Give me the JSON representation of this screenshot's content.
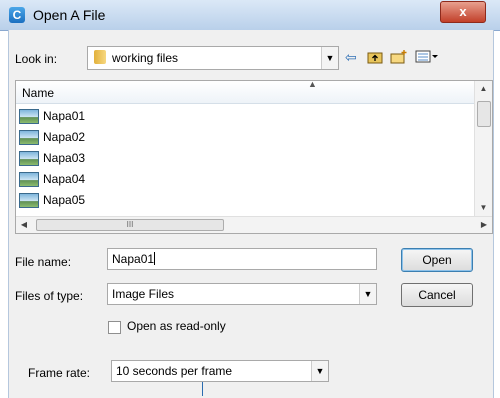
{
  "window": {
    "title": "Open A File",
    "close_glyph": "x",
    "app_icon_glyph": "C"
  },
  "toolbar": {
    "look_in_label": "Look in:",
    "look_in_value": "working files",
    "back_icon": "back-arrow-icon",
    "up_icon": "up-folder-icon",
    "new_folder_icon": "new-folder-icon",
    "view_menu_icon": "view-menu-icon"
  },
  "list": {
    "column_name": "Name",
    "items": [
      "Napa01",
      "Napa02",
      "Napa03",
      "Napa04",
      "Napa05"
    ]
  },
  "form": {
    "file_name_label": "File name:",
    "file_name_value": "Napa01",
    "files_of_type_label": "Files of type:",
    "files_of_type_value": "Image Files",
    "read_only_label": "Open as read-only",
    "frame_rate_label": "Frame rate:",
    "frame_rate_value": "10 seconds per frame"
  },
  "buttons": {
    "open": "Open",
    "cancel": "Cancel"
  },
  "colors": {
    "accent": "#3c7fb1",
    "close": "#c2402a"
  }
}
